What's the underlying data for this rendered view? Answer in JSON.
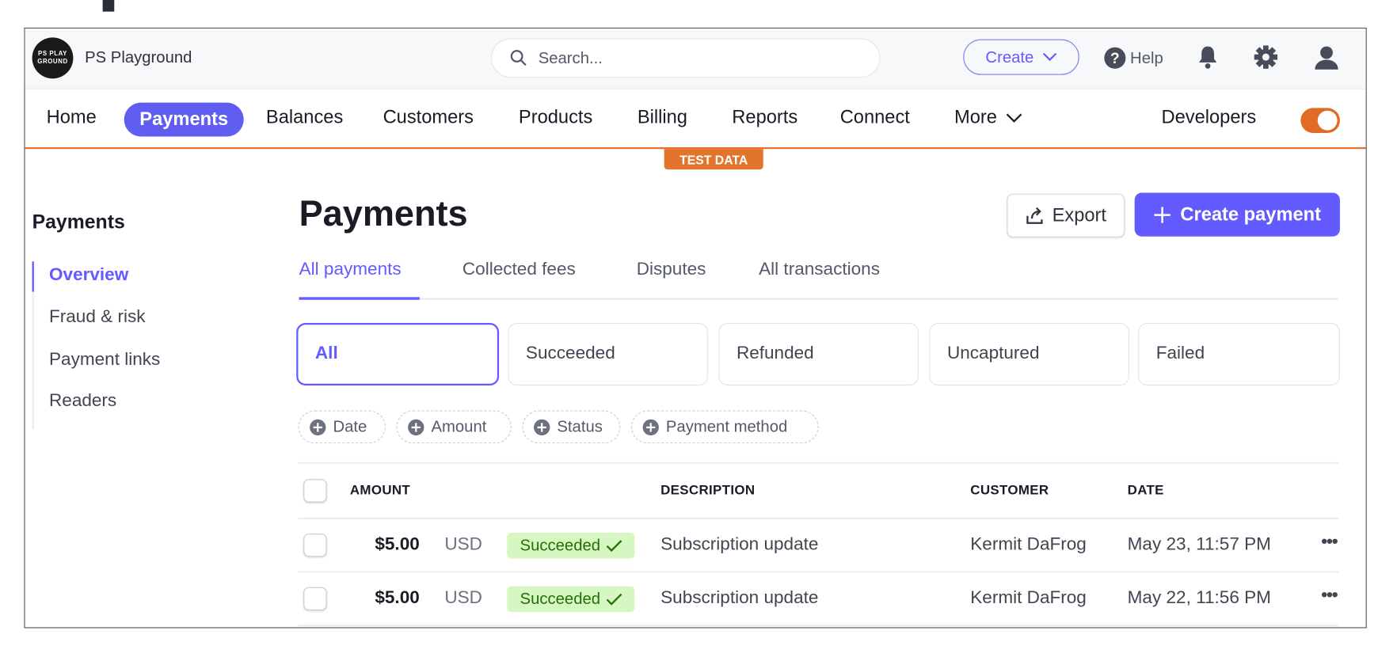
{
  "header": {
    "logo_text": "PS PLAYGROUND",
    "account_name": "PS Playground",
    "search_placeholder": "Search...",
    "create_label": "Create",
    "help_label": "Help"
  },
  "nav": {
    "items": [
      "Home",
      "Payments",
      "Balances",
      "Customers",
      "Products",
      "Billing",
      "Reports",
      "Connect",
      "More"
    ],
    "active": "Payments",
    "developers_label": "Developers",
    "test_mode_on": true,
    "test_badge": "TEST DATA"
  },
  "colors": {
    "accent": "#635bff",
    "test_mode": "#e3742b",
    "success_bg": "#d7f7c2",
    "success_text": "#217005"
  },
  "sidebar": {
    "title": "Payments",
    "items": [
      "Overview",
      "Fraud & risk",
      "Payment links",
      "Readers"
    ],
    "active": "Overview"
  },
  "main": {
    "title": "Payments",
    "export_label": "Export",
    "create_payment_label": "Create payment",
    "tabs": [
      "All payments",
      "Collected fees",
      "Disputes",
      "All transactions"
    ],
    "active_tab": "All payments",
    "status_cards": [
      "All",
      "Succeeded",
      "Refunded",
      "Uncaptured",
      "Failed"
    ],
    "active_status": "All",
    "filters": [
      "Date",
      "Amount",
      "Status",
      "Payment method"
    ]
  },
  "table": {
    "columns": [
      "AMOUNT",
      "DESCRIPTION",
      "CUSTOMER",
      "DATE"
    ],
    "rows": [
      {
        "amount": "$5.00",
        "currency": "USD",
        "status": "Succeeded",
        "description": "Subscription update",
        "customer": "Kermit DaFrog",
        "date": "May 23, 11:57 PM"
      },
      {
        "amount": "$5.00",
        "currency": "USD",
        "status": "Succeeded",
        "description": "Subscription update",
        "customer": "Kermit DaFrog",
        "date": "May 22, 11:56 PM"
      }
    ]
  }
}
